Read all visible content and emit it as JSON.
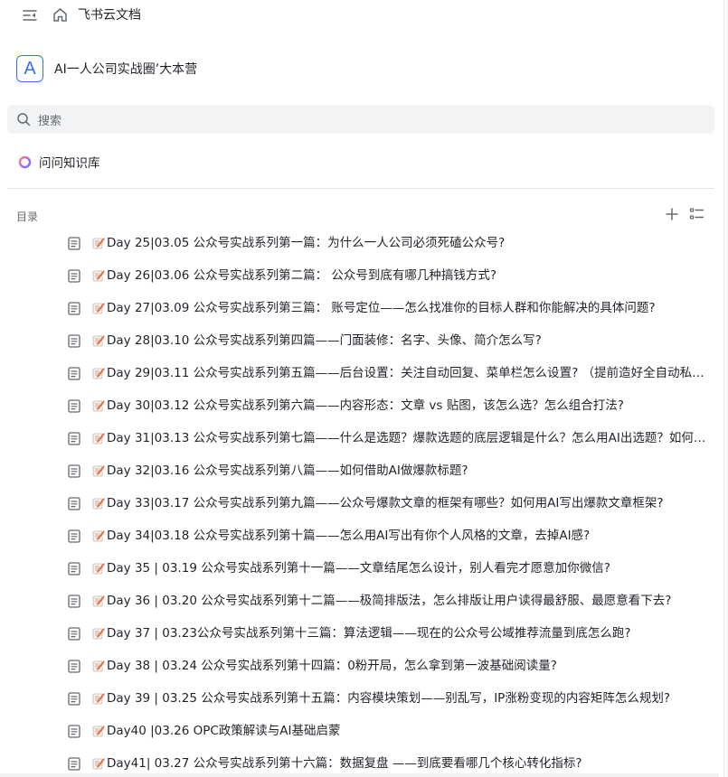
{
  "topbar": {
    "title": "飞书云文档",
    "icons": [
      "sidebar-collapse-icon",
      "home-icon"
    ]
  },
  "workspace": {
    "logo_letter": "A",
    "name": "AI一人公司实战圈’大本营"
  },
  "search": {
    "placeholder": "搜索"
  },
  "ask": {
    "label": "问问知识库"
  },
  "directory": {
    "title": "目录",
    "items": [
      {
        "title": "Day 25|03.05 公众号实战系列第一篇：为什么一人公司必须死磕公众号?"
      },
      {
        "title": "Day 26|03.06 公众号实战系列第二篇： 公众号到底有哪几种搞钱方式?"
      },
      {
        "title": "Day 27|03.09 公众号实战系列第三篇： 账号定位——怎么找准你的目标人群和你能解决的具体问题?"
      },
      {
        "title": "Day 28|03.10 公众号实战系列第四篇——门面装修：名字、头像、简介怎么写?"
      },
      {
        "title": "Day 29|03.11 公众号实战系列第五篇——后台设置：关注自动回复、菜单栏怎么设置? （提前造好全自动私域流量入口）"
      },
      {
        "title": "Day 30|03.12 公众号实战系列第六篇——内容形态：文章 vs 贴图，该怎么选？怎么组合打法?"
      },
      {
        "title": "Day 31|03.13 公众号实战系列第七篇——什么是选题？爆款选题的底层逻辑是什么？怎么用AI出选题？如何建立选题库?"
      },
      {
        "title": "Day 32|03.16 公众号实战系列第八篇——如何借助AI做爆款标题?"
      },
      {
        "title": "Day 33|03.17 公众号实战系列第九篇——公众号爆款文章的框架有哪些？如何用AI写出爆款文章框架?"
      },
      {
        "title": "Day 34|03.18 公众号实战系列第十篇——怎么用AI写出有你个人风格的文章，去掉AI感?"
      },
      {
        "title": "Day 35 | 03.19 公众号实战系列第十一篇——文章结尾怎么设计，别人看完才愿意加你微信?"
      },
      {
        "title": "Day 36 | 03.20 公众号实战系列第十二篇——极简排版法，怎么排版让用户读得最舒服、最愿意看下去?"
      },
      {
        "title": "Day 37 | 03.23公众号实战系列第十三篇：算法逻辑——现在的公众号公域推荐流量到底怎么跑?"
      },
      {
        "title": "Day 38 | 03.24 公众号实战系列第十四篇：0粉开局，怎么拿到第一波基础阅读量?"
      },
      {
        "title": "Day 39 | 03.25 公众号实战系列第十五篇：内容模块策划——别乱写，IP涨粉变现的内容矩阵怎么规划?"
      },
      {
        "title": "Day40 |03.26 OPC政策解读与AI基础启蒙"
      },
      {
        "title": "Day41| 03.27 公众号实战系列第十六篇：数据复盘 ——到底要看哪几个核心转化指标?"
      }
    ]
  },
  "colors": {
    "accent": "#3370ff",
    "text": "#1f2329",
    "muted": "#646a73",
    "search_bg": "#f2f3f5"
  }
}
